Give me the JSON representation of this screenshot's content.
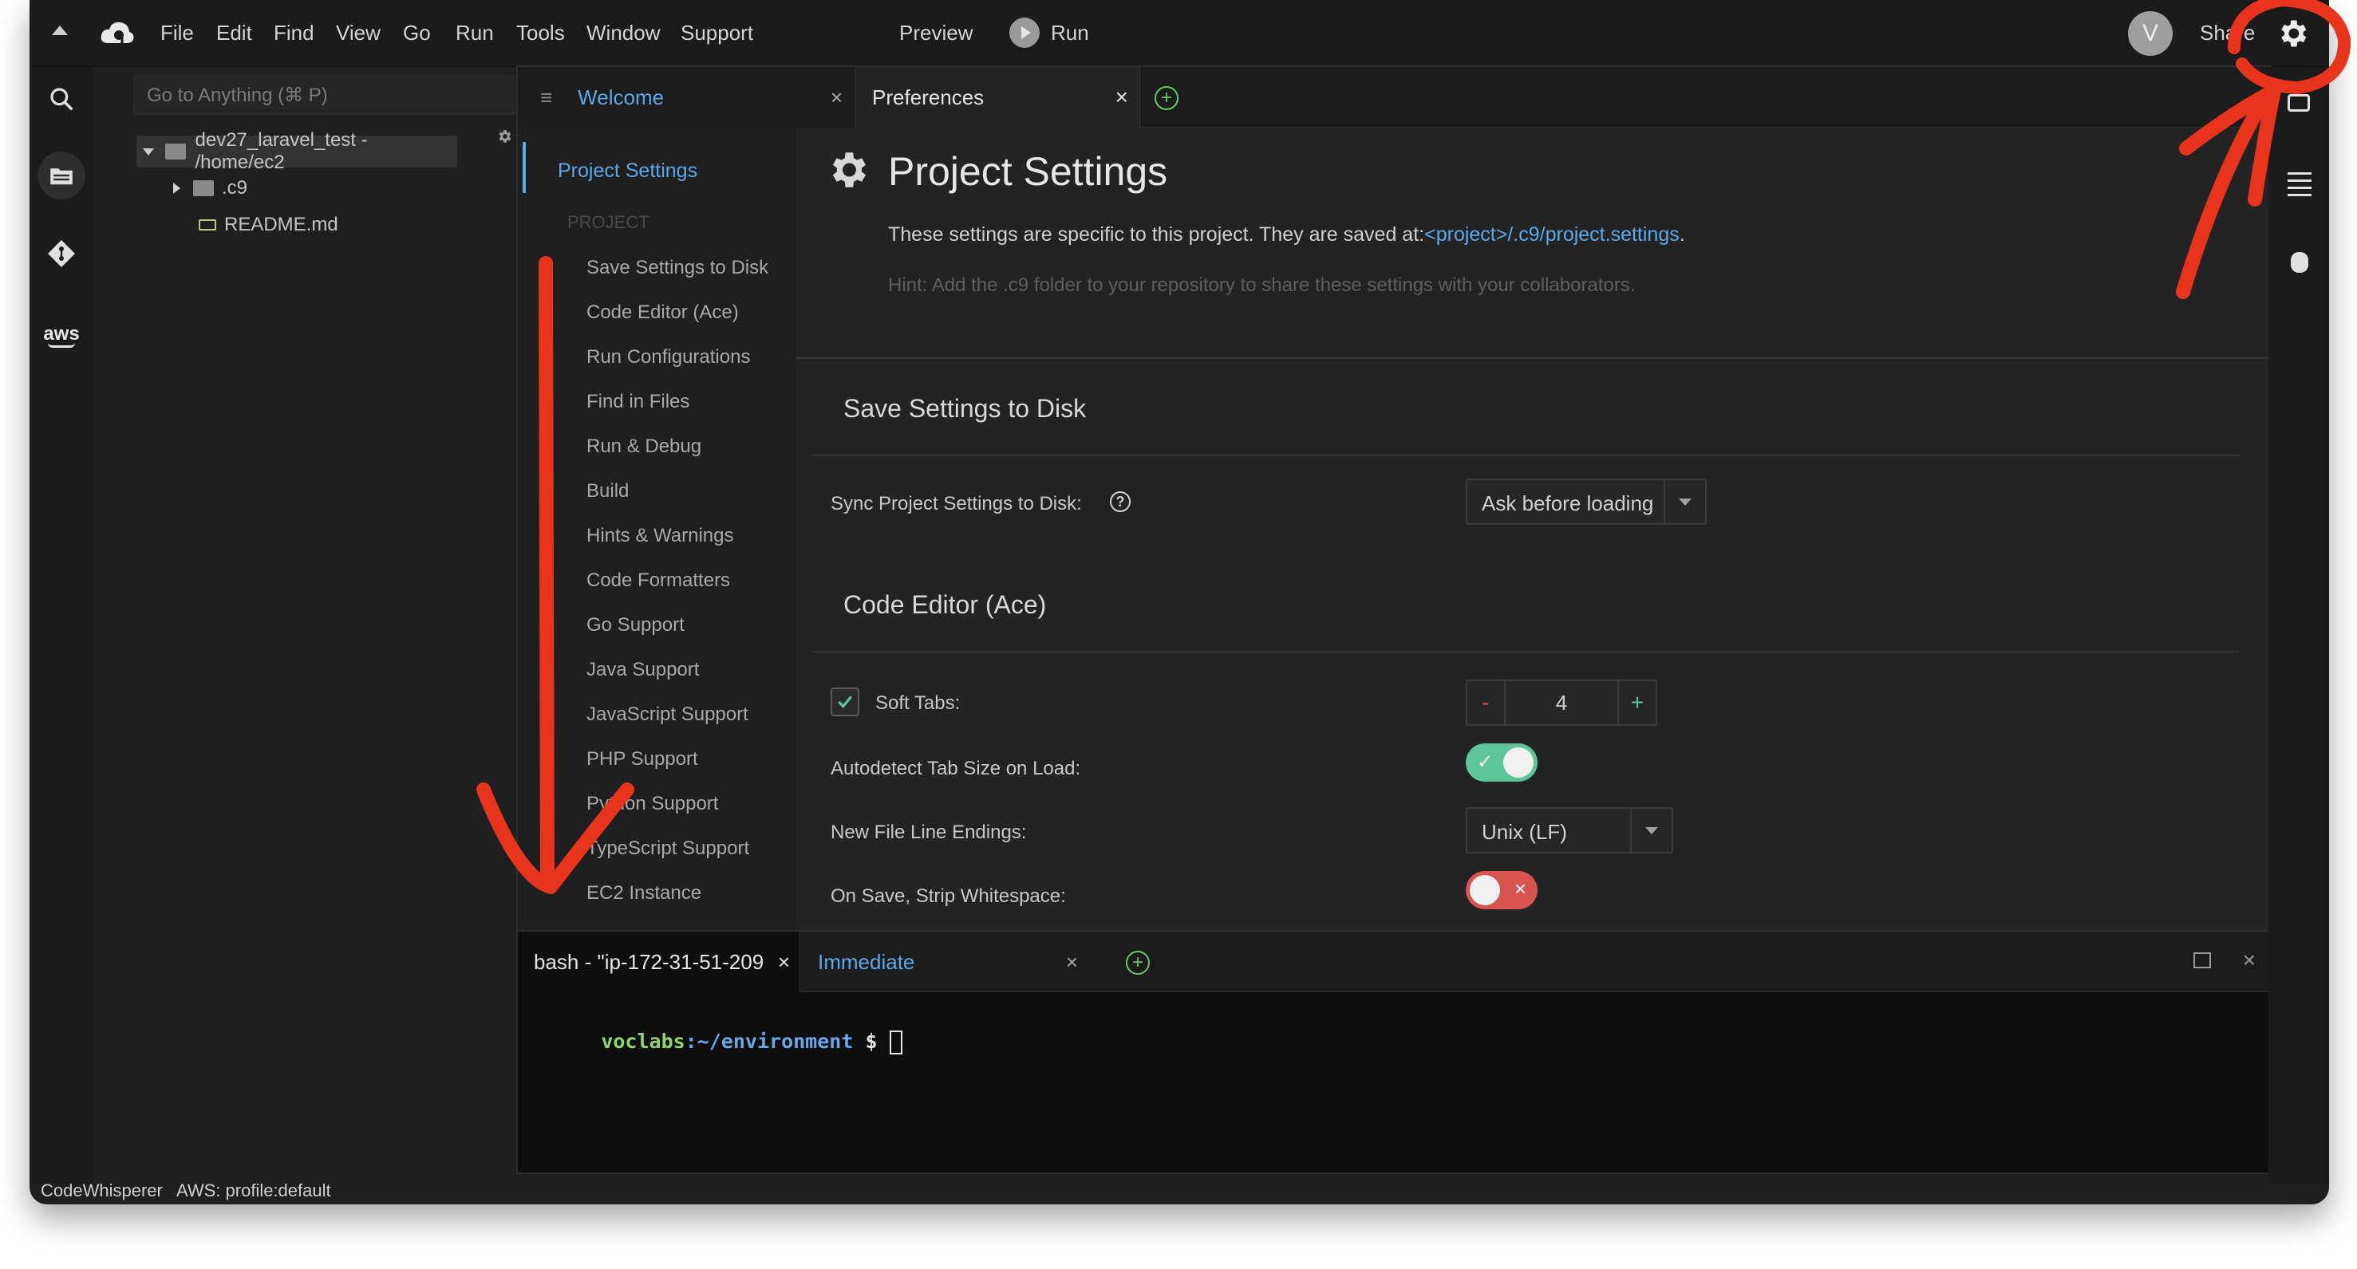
{
  "menubar": {
    "items": [
      "File",
      "Edit",
      "Find",
      "View",
      "Go",
      "Run",
      "Tools",
      "Window",
      "Support"
    ],
    "preview": "Preview",
    "run": "Run",
    "avatar_letter": "V",
    "share": "Share"
  },
  "filetree": {
    "search_placeholder": "Go to Anything (⌘ P)",
    "root": "dev27_laravel_test - /home/ec2",
    "folder": ".c9",
    "file": "README.md"
  },
  "tabs": {
    "welcome": "Welcome",
    "preferences": "Preferences"
  },
  "pref_nav": {
    "project_settings": "Project Settings",
    "group": "PROJECT",
    "items": [
      "Save Settings to Disk",
      "Code Editor (Ace)",
      "Run Configurations",
      "Find in Files",
      "Run & Debug",
      "Build",
      "Hints & Warnings",
      "Code Formatters",
      "Go Support",
      "Java Support",
      "JavaScript Support",
      "PHP Support",
      "Python Support",
      "TypeScript Support",
      "EC2 Instance"
    ]
  },
  "main": {
    "title": "Project Settings",
    "desc_prefix": "These settings are specific to this project. They are saved at:",
    "desc_link": "<project>/.c9/project.settings",
    "desc_suffix": ".",
    "hint": "Hint: Add the .c9 folder to your repository to share these settings with your collaborators.",
    "section1": "Save Settings to Disk",
    "sync_label": "Sync Project Settings to Disk:",
    "sync_value": "Ask before loading",
    "section2": "Code Editor (Ace)",
    "soft_tabs_label": "Soft Tabs:",
    "soft_tabs_value": "4",
    "stepper_minus": "-",
    "stepper_plus": "+",
    "autodetect_label": "Autodetect Tab Size on Load:",
    "autodetect_on": true,
    "line_endings_label": "New File Line Endings:",
    "line_endings_value": "Unix (LF)",
    "strip_ws_label": "On Save, Strip Whitespace:",
    "strip_ws_on": false
  },
  "terminal": {
    "tab_bash": "bash - \"ip-172-31-51-209.",
    "tab_immediate": "Immediate",
    "prompt_user": "voclabs",
    "prompt_path": ":~/environment",
    "prompt_symbol": " $ "
  },
  "statusbar": {
    "codewhisperer": "CodeWhisperer",
    "aws_profile": "AWS: profile:default"
  },
  "colors": {
    "accent_blue": "#5aa9e6",
    "toggle_on": "#5ec49a",
    "toggle_off": "#d9534f",
    "annotation_red": "#e8341c"
  }
}
